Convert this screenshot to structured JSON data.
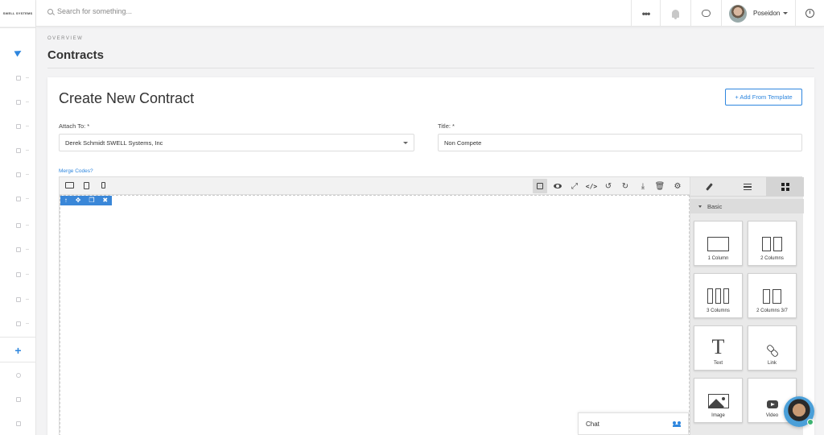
{
  "sidebar": {
    "logo": "SWELL SYSTEMS",
    "items": [
      "send-icon",
      "doc-icon",
      "doc-icon",
      "list-icon",
      "folder-icon",
      "check-icon",
      "mail-icon",
      "doc-icon",
      "doc-icon",
      "copy-icon",
      "doc-icon",
      "file-icon"
    ],
    "add": "+",
    "bottom_items": [
      "help-icon",
      "megaphone-icon",
      "book-icon"
    ]
  },
  "topbar": {
    "search_placeholder": "Search for something...",
    "more": "•••",
    "user_name": "Poseidon"
  },
  "page": {
    "overview": "OVERVIEW",
    "title": "Contracts"
  },
  "card": {
    "title": "Create New Contract",
    "template_button": "+ Add From Template",
    "attach_label": "Attach To: *",
    "attach_value": "Derek Schmidt SWELL Systems, Inc",
    "title_label": "Title: *",
    "title_value": "Non Compete",
    "merge_link": "Merge Codes?"
  },
  "editor": {
    "category": "Basic",
    "blocks": [
      {
        "label": "1 Column",
        "icon": "one-column-icon"
      },
      {
        "label": "2 Columns",
        "icon": "two-columns-icon"
      },
      {
        "label": "3 Columns",
        "icon": "three-columns-icon"
      },
      {
        "label": "2 Columns 3/7",
        "icon": "two-columns-37-icon"
      },
      {
        "label": "Text",
        "icon": "text-icon"
      },
      {
        "label": "Link",
        "icon": "link-icon"
      },
      {
        "label": "Image",
        "icon": "image-icon"
      },
      {
        "label": "Video",
        "icon": "video-icon"
      }
    ]
  },
  "chat": {
    "label": "Chat"
  },
  "colors": {
    "accent": "#2e86de",
    "selection": "#3a87d8",
    "online": "#3cb371"
  }
}
